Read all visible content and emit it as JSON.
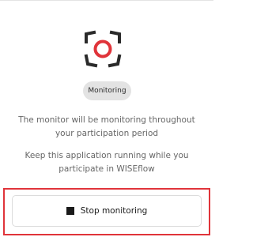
{
  "status": {
    "badge_label": "Monitoring",
    "message_primary": "The monitor will be monitoring throughout your participation period",
    "message_secondary": "Keep this application running while you participate in WISEflow"
  },
  "actions": {
    "stop_label": "Stop monitoring"
  },
  "icons": {
    "logo": "focus-frame-record-icon",
    "stop": "stop-square-icon"
  },
  "colors": {
    "accent": "#e0343a",
    "frame": "#2a2a2a",
    "badge_bg": "#e3e3e3",
    "muted_text": "#666666"
  }
}
